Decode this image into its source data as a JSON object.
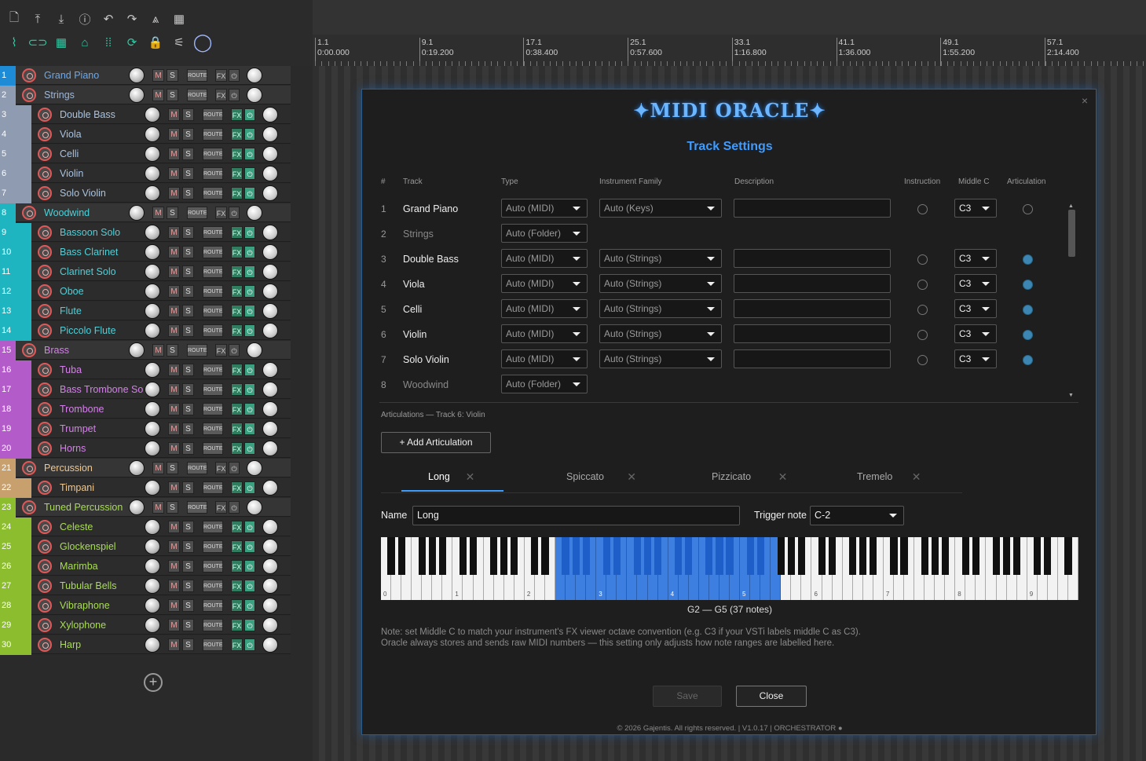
{
  "toolbar": {
    "top_icons": [
      "new-file-icon",
      "import-icon",
      "export-icon",
      "info-icon",
      "undo-icon",
      "redo-icon",
      "metronome-icon",
      "marquee-icon"
    ],
    "bottom_icons": [
      "snap-icon",
      "link-icon",
      "grid-icon",
      "group-icon",
      "ripple-icon",
      "loop-icon",
      "lock-icon",
      "mute-tool-icon",
      "logo-o-icon"
    ]
  },
  "tracks": [
    {
      "num": "1",
      "name": "Grand Piano",
      "folder": true,
      "color": "#1e8bd6",
      "name_color": "#6ea8e8"
    },
    {
      "num": "2",
      "name": "Strings",
      "folder": true,
      "color": "#8f9bb0",
      "name_color": "#9fb7d8"
    },
    {
      "num": "3",
      "name": "Double Bass",
      "folder": false,
      "color": "#8f9bb0",
      "name_color": "#a9c3e0"
    },
    {
      "num": "4",
      "name": "Viola",
      "folder": false,
      "color": "#8f9bb0",
      "name_color": "#a9c3e0"
    },
    {
      "num": "5",
      "name": "Celli",
      "folder": false,
      "color": "#8f9bb0",
      "name_color": "#a9c3e0"
    },
    {
      "num": "6",
      "name": "Violin",
      "folder": false,
      "color": "#8f9bb0",
      "name_color": "#a9c3e0"
    },
    {
      "num": "7",
      "name": "Solo Violin",
      "folder": false,
      "color": "#8f9bb0",
      "name_color": "#a9c3e0"
    },
    {
      "num": "8",
      "name": "Woodwind",
      "folder": true,
      "color": "#1fb5c0",
      "name_color": "#4ed0d8"
    },
    {
      "num": "9",
      "name": "Bassoon Solo",
      "folder": false,
      "color": "#1fb5c0",
      "name_color": "#4ed0d8"
    },
    {
      "num": "10",
      "name": "Bass Clarinet",
      "folder": false,
      "color": "#1fb5c0",
      "name_color": "#4ed0d8"
    },
    {
      "num": "11",
      "name": "Clarinet Solo",
      "folder": false,
      "color": "#1fb5c0",
      "name_color": "#4ed0d8"
    },
    {
      "num": "12",
      "name": "Oboe",
      "folder": false,
      "color": "#1fb5c0",
      "name_color": "#4ed0d8"
    },
    {
      "num": "13",
      "name": "Flute",
      "folder": false,
      "color": "#1fb5c0",
      "name_color": "#4ed0d8"
    },
    {
      "num": "14",
      "name": "Piccolo Flute",
      "folder": false,
      "color": "#1fb5c0",
      "name_color": "#4ed0d8"
    },
    {
      "num": "15",
      "name": "Brass",
      "folder": true,
      "color": "#b35cc9",
      "name_color": "#d580ea"
    },
    {
      "num": "16",
      "name": "Tuba",
      "folder": false,
      "color": "#b35cc9",
      "name_color": "#d580ea"
    },
    {
      "num": "17",
      "name": "Bass Trombone So",
      "folder": false,
      "color": "#b35cc9",
      "name_color": "#d580ea"
    },
    {
      "num": "18",
      "name": "Trombone",
      "folder": false,
      "color": "#b35cc9",
      "name_color": "#d580ea"
    },
    {
      "num": "19",
      "name": "Trumpet",
      "folder": false,
      "color": "#b35cc9",
      "name_color": "#d580ea"
    },
    {
      "num": "20",
      "name": "Horns",
      "folder": false,
      "color": "#b35cc9",
      "name_color": "#d580ea"
    },
    {
      "num": "21",
      "name": "Percussion",
      "folder": true,
      "color": "#c8a06e",
      "name_color": "#f0c890"
    },
    {
      "num": "22",
      "name": "Timpani",
      "folder": false,
      "color": "#c8a06e",
      "name_color": "#f0c890"
    },
    {
      "num": "23",
      "name": "Tuned Percussion",
      "folder": true,
      "color": "#8bbd2e",
      "name_color": "#a8de50"
    },
    {
      "num": "24",
      "name": "Celeste",
      "folder": false,
      "color": "#8bbd2e",
      "name_color": "#a8de50"
    },
    {
      "num": "25",
      "name": "Glockenspiel",
      "folder": false,
      "color": "#8bbd2e",
      "name_color": "#a8de50"
    },
    {
      "num": "26",
      "name": "Marimba",
      "folder": false,
      "color": "#8bbd2e",
      "name_color": "#a8de50"
    },
    {
      "num": "27",
      "name": "Tubular Bells",
      "folder": false,
      "color": "#8bbd2e",
      "name_color": "#a8de50"
    },
    {
      "num": "28",
      "name": "Vibraphone",
      "folder": false,
      "color": "#8bbd2e",
      "name_color": "#a8de50"
    },
    {
      "num": "29",
      "name": "Xylophone",
      "folder": false,
      "color": "#8bbd2e",
      "name_color": "#a8de50"
    },
    {
      "num": "30",
      "name": "Harp",
      "folder": false,
      "color": "#8bbd2e",
      "name_color": "#a8de50"
    }
  ],
  "track_buttons": {
    "mute": "M",
    "solo": "S",
    "route": "ROUTE",
    "fx": "FX",
    "power": "⏻"
  },
  "add_track_label": "+",
  "ruler": [
    {
      "bar": "1.1",
      "time": "0:00.000"
    },
    {
      "bar": "9.1",
      "time": "0:19.200"
    },
    {
      "bar": "17.1",
      "time": "0:38.400"
    },
    {
      "bar": "25.1",
      "time": "0:57.600"
    },
    {
      "bar": "33.1",
      "time": "1:16.800"
    },
    {
      "bar": "41.1",
      "time": "1:36.000"
    },
    {
      "bar": "49.1",
      "time": "1:55.200"
    },
    {
      "bar": "57.1",
      "time": "2:14.400"
    }
  ],
  "dialog": {
    "close_x": "×",
    "logo": "✦MIDI ORACLE✦",
    "title": "Track Settings",
    "headers": {
      "num": "#",
      "track": "Track",
      "type": "Type",
      "family": "Instrument Family",
      "description": "Description",
      "instruction": "Instruction",
      "middle_c": "Middle C",
      "articulation": "Articulation"
    },
    "rows": [
      {
        "num": "1",
        "track": "Grand Piano",
        "type": "Auto (MIDI)",
        "family": "Auto (Keys)",
        "middle_c": "C3",
        "folder": false,
        "articulation": false
      },
      {
        "num": "2",
        "track": "Strings",
        "type": "Auto (Folder)",
        "folder": true
      },
      {
        "num": "3",
        "track": "Double Bass",
        "type": "Auto (MIDI)",
        "family": "Auto (Strings)",
        "middle_c": "C3",
        "folder": false,
        "articulation": true
      },
      {
        "num": "4",
        "track": "Viola",
        "type": "Auto (MIDI)",
        "family": "Auto (Strings)",
        "middle_c": "C3",
        "folder": false,
        "articulation": true
      },
      {
        "num": "5",
        "track": "Celli",
        "type": "Auto (MIDI)",
        "family": "Auto (Strings)",
        "middle_c": "C3",
        "folder": false,
        "articulation": true
      },
      {
        "num": "6",
        "track": "Violin",
        "type": "Auto (MIDI)",
        "family": "Auto (Strings)",
        "middle_c": "C3",
        "folder": false,
        "articulation": true
      },
      {
        "num": "7",
        "track": "Solo Violin",
        "type": "Auto (MIDI)",
        "family": "Auto (Strings)",
        "middle_c": "C3",
        "folder": false,
        "articulation": true
      },
      {
        "num": "8",
        "track": "Woodwind",
        "type": "Auto (Folder)",
        "folder": true
      }
    ],
    "articulations_label": "Articulations — Track 6: Violin",
    "add_articulation": "+ Add Articulation",
    "tabs": [
      {
        "label": "Long",
        "active": true
      },
      {
        "label": "Spiccato",
        "active": false
      },
      {
        "label": "Pizzicato",
        "active": false
      },
      {
        "label": "Tremelo",
        "active": false
      }
    ],
    "tab_close": "✕",
    "name_label": "Name",
    "name_value": "Long",
    "trigger_label": "Trigger note",
    "trigger_value": "C-2",
    "keyboard": {
      "octave_labels": [
        "0",
        "1",
        "2",
        "3",
        "4",
        "5",
        "6",
        "7",
        "8",
        "9"
      ],
      "range_start_white": 17,
      "range_end_white": 38
    },
    "range_text": "G2  —  G5  (37 notes)",
    "note_line1": "Note: set Middle C to match your instrument's FX viewer octave convention (e.g. C3 if your VSTi labels middle C as C3).",
    "note_line2": "Oracle always stores and sends raw MIDI numbers — this setting only adjusts how note ranges are labelled here.",
    "save": "Save",
    "close": "Close",
    "footer": "© 2026 Gajentis. All rights reserved.  |  V1.0.17  |  ORCHESTRATOR ●"
  }
}
